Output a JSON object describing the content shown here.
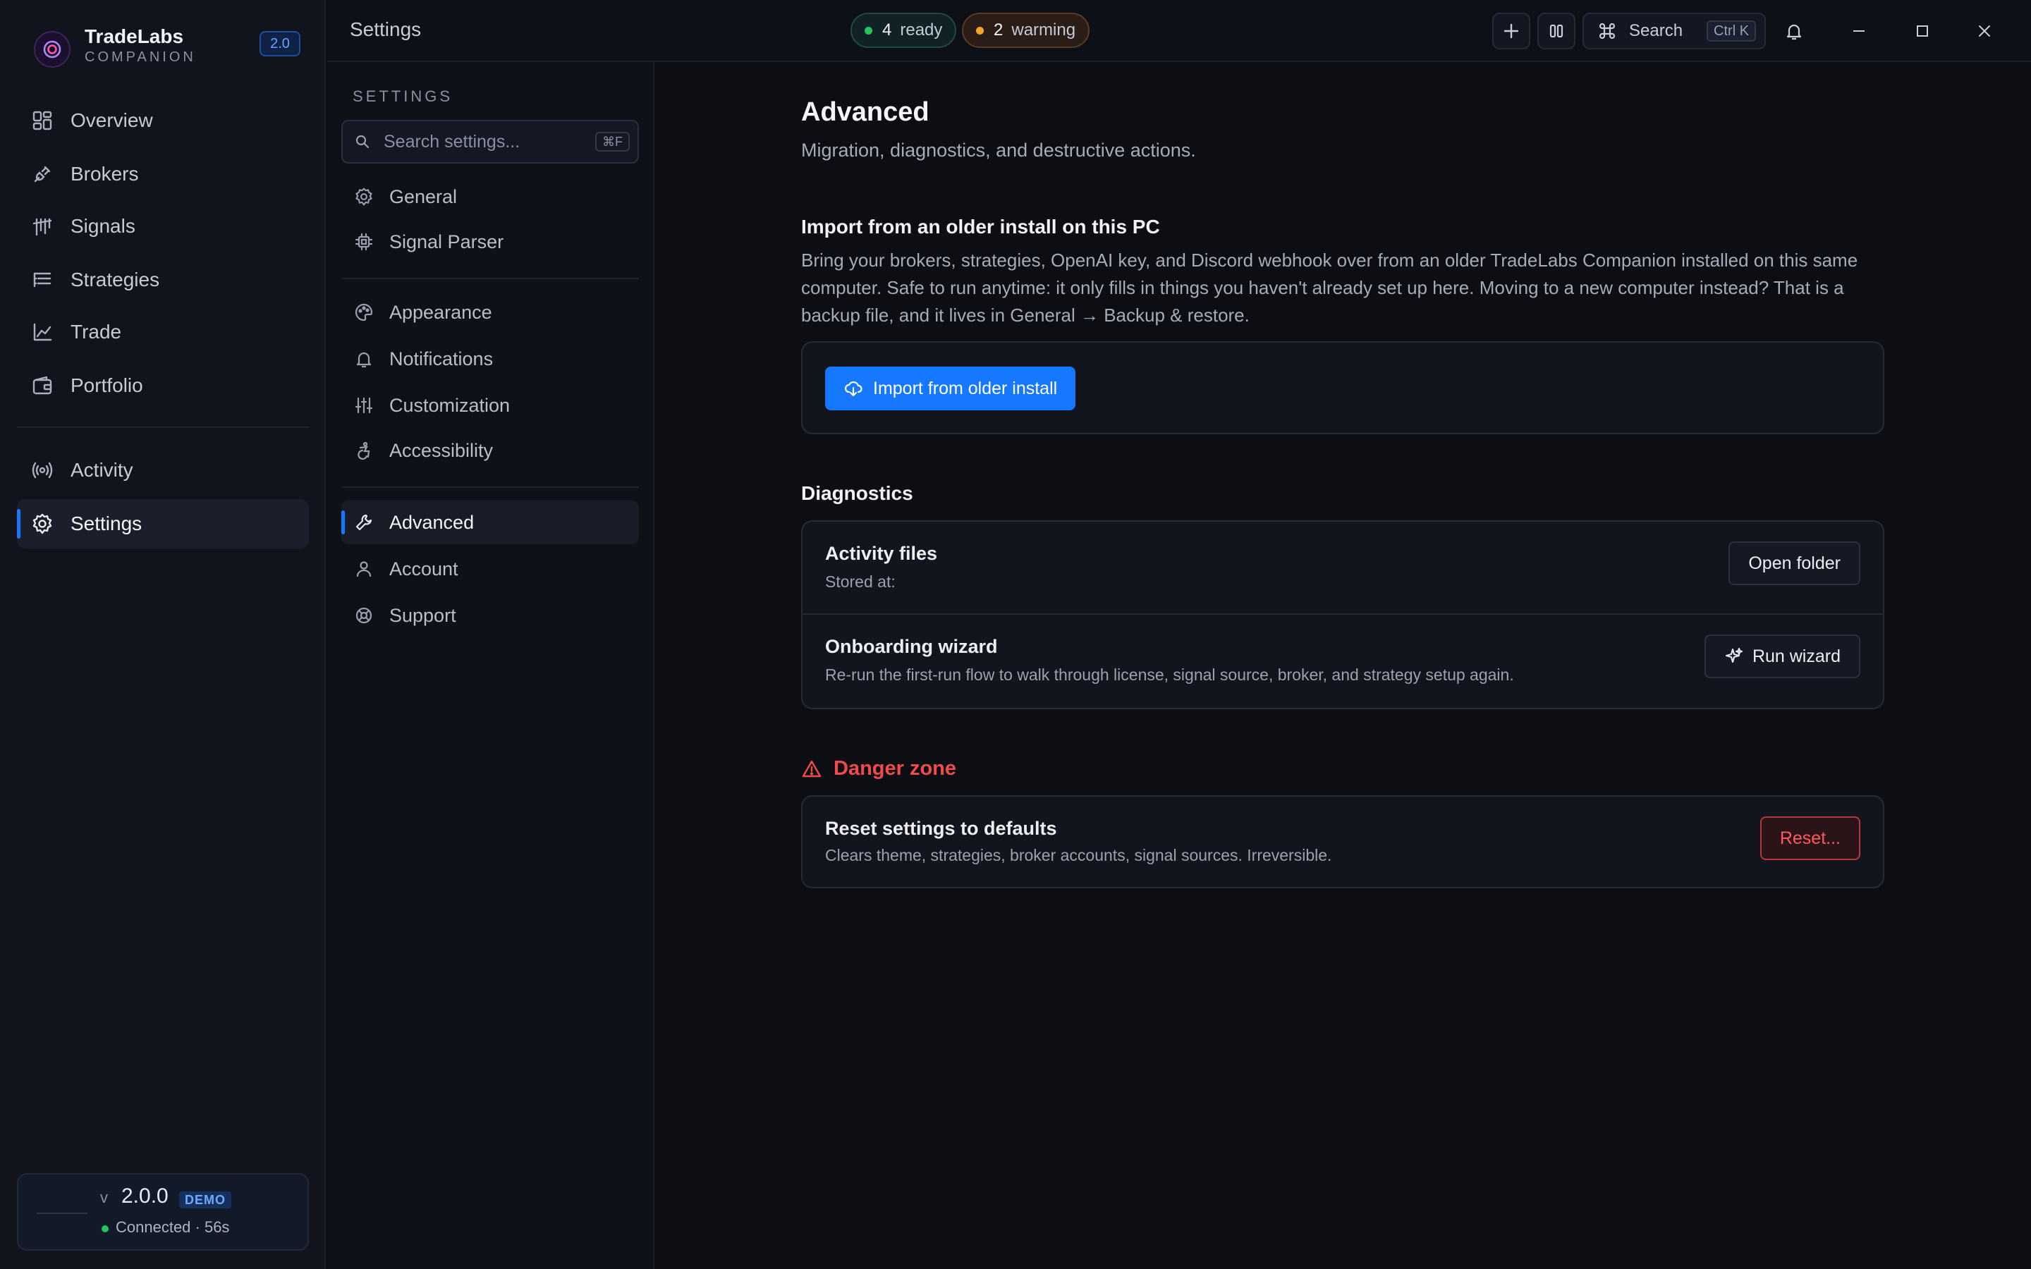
{
  "app": {
    "name": "TradeLabs",
    "subtitle": "COMPANION",
    "version_badge": "2.0"
  },
  "sidebar": {
    "items": [
      {
        "label": "Overview",
        "icon": "grid-icon"
      },
      {
        "label": "Brokers",
        "icon": "plug-icon"
      },
      {
        "label": "Signals",
        "icon": "signal-icon"
      },
      {
        "label": "Strategies",
        "icon": "list-tree-icon"
      },
      {
        "label": "Trade",
        "icon": "line-chart-icon"
      },
      {
        "label": "Portfolio",
        "icon": "wallet-icon"
      },
      {
        "label": "Activity",
        "icon": "broadcast-icon"
      },
      {
        "label": "Settings",
        "icon": "gear-icon",
        "active": true
      }
    ],
    "status": {
      "version_prefix": "v",
      "version": "2.0.0",
      "mode_badge": "DEMO",
      "connection": "Connected · 56s"
    }
  },
  "topbar": {
    "title": "Settings",
    "ready_count": "4",
    "ready_label": "ready",
    "warming_count": "2",
    "warming_label": "warming",
    "search_label": "Search",
    "search_shortcut": "Ctrl K"
  },
  "settings_nav": {
    "heading": "SETTINGS",
    "search_placeholder": "Search settings...",
    "search_shortcut": "⌘F",
    "groups": [
      [
        {
          "label": "General",
          "icon": "gear-icon"
        },
        {
          "label": "Signal Parser",
          "icon": "chip-icon"
        }
      ],
      [
        {
          "label": "Appearance",
          "icon": "palette-icon"
        },
        {
          "label": "Notifications",
          "icon": "bell-icon"
        },
        {
          "label": "Customization",
          "icon": "sliders-icon"
        },
        {
          "label": "Accessibility",
          "icon": "accessibility-icon"
        }
      ],
      [
        {
          "label": "Advanced",
          "icon": "wrench-icon",
          "active": true
        },
        {
          "label": "Account",
          "icon": "user-icon"
        },
        {
          "label": "Support",
          "icon": "lifebuoy-icon"
        }
      ]
    ]
  },
  "main": {
    "title": "Advanced",
    "subtitle": "Migration, diagnostics, and destructive actions.",
    "import": {
      "title": "Import from an older install on this PC",
      "body": "Bring your brokers, strategies, OpenAI key, and Discord webhook over from an older TradeLabs Companion installed on this same computer. Safe to run anytime: it only fills in things you haven't already set up here. Moving to a new computer instead? That is a backup file, and it lives in General → Backup & restore.",
      "button": "Import from older install"
    },
    "diagnostics": {
      "title": "Diagnostics",
      "rows": [
        {
          "title": "Activity files",
          "subtitle": "Stored at:",
          "button": "Open folder"
        },
        {
          "title": "Onboarding wizard",
          "subtitle": "Re-run the first-run flow to walk through license, signal source, broker, and strategy setup again.",
          "button": "Run wizard"
        }
      ]
    },
    "danger": {
      "title": "Danger zone",
      "row_title": "Reset settings to defaults",
      "row_subtitle": "Clears theme, strategies, broker accounts, signal sources. Irreversible.",
      "button": "Reset..."
    }
  },
  "colors": {
    "accent": "#1677ff",
    "danger": "#ef4b4b",
    "ready": "#22c55e",
    "warming": "#f5a524"
  }
}
